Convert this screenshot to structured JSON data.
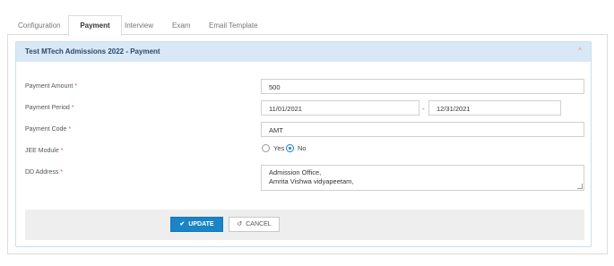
{
  "tabs": [
    {
      "label": "Configuration"
    },
    {
      "label": "Payment"
    },
    {
      "label": "Interview"
    },
    {
      "label": "Exam"
    },
    {
      "label": "Email Template"
    }
  ],
  "panel": {
    "title": "Test MTech Admissions 2022 - Payment",
    "caret": "^"
  },
  "form": {
    "amount": {
      "label": "Payment Amount",
      "required": "*",
      "value": "500"
    },
    "period": {
      "label": "Payment Period",
      "required": "*",
      "start": "11/01/2021",
      "separator": "-",
      "end": "12/31/2021"
    },
    "code": {
      "label": "Payment Code",
      "required": "*",
      "value": "AMT"
    },
    "jee": {
      "label": "JEE Module",
      "required": "*",
      "options": [
        "Yes",
        "No"
      ],
      "selected": "No"
    },
    "dd_address": {
      "label": "DD Address",
      "required": "*",
      "lines": [
        "Admission Office,",
        "Amrita Vishwa vidyapeetam,"
      ]
    }
  },
  "actions": {
    "update_label": "UPDATE",
    "cancel_label": "CANCEL",
    "update_icon": "check-icon",
    "cancel_icon": "undo-icon"
  },
  "colors": {
    "accent": "#1a84c6",
    "panel_header": "#d8e8f7",
    "required": "#e05050"
  }
}
